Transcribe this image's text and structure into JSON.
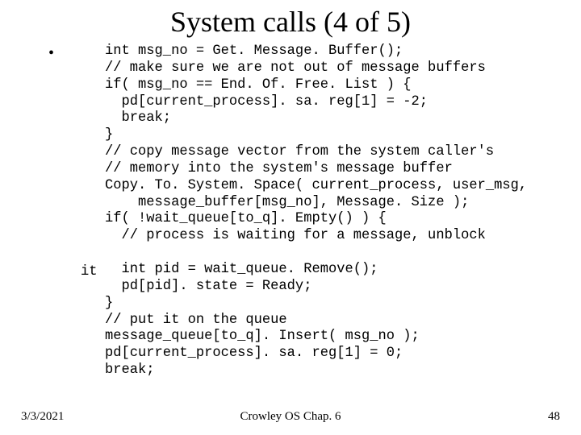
{
  "title": "System calls (4 of 5)",
  "bullet": "•",
  "code_block_1": "int msg_no = Get. Message. Buffer();\n// make sure we are not out of message buffers\nif( msg_no == End. Of. Free. List ) {\n  pd[current_process]. sa. reg[1] = -2;\n  break;\n}\n// copy message vector from the system caller's\n// memory into the system's message buffer\nCopy. To. System. Space( current_process, user_msg,\n    message_buffer[msg_no], Message. Size );\nif( !wait_queue[to_q]. Empty() ) {\n  // process is waiting for a message, unblock",
  "it_label": "it",
  "code_block_2": "  int pid = wait_queue. Remove();\n  pd[pid]. state = Ready;\n}\n// put it on the queue\nmessage_queue[to_q]. Insert( msg_no );\npd[current_process]. sa. reg[1] = 0;\nbreak;",
  "footer": {
    "date": "3/3/2021",
    "center": "Crowley    OS     Chap. 6",
    "page": "48"
  }
}
